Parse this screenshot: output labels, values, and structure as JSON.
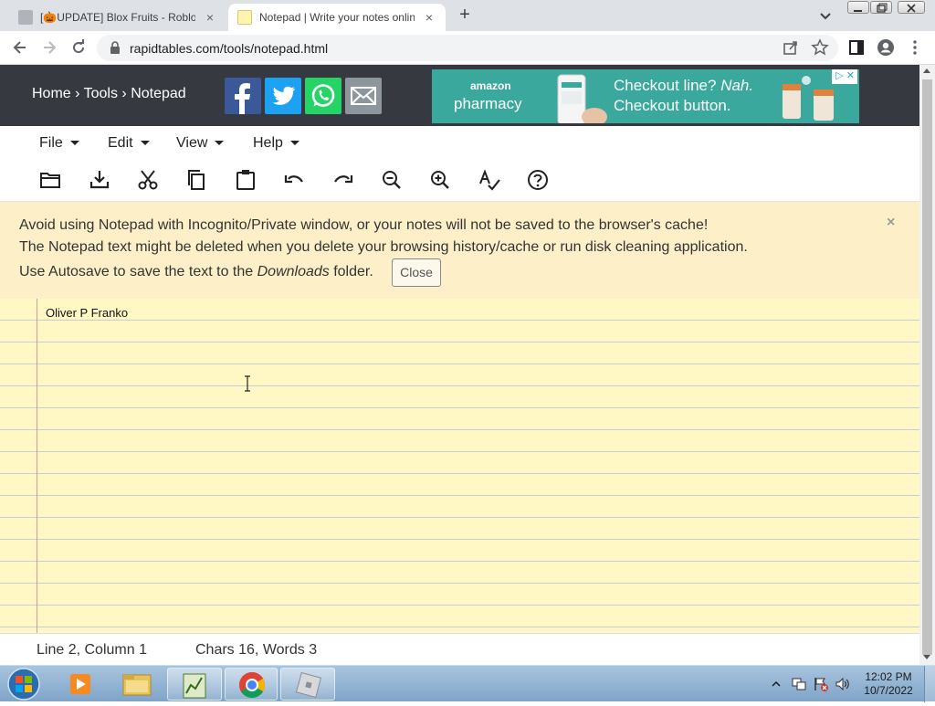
{
  "browser": {
    "tabs": [
      {
        "title": "[🎃UPDATE] Blox Fruits - Roblo",
        "active": false
      },
      {
        "title": "Notepad | Write your notes onlin",
        "active": true
      }
    ],
    "new_tab": "+",
    "close_glyph": "×",
    "url": "rapidtables.com/tools/notepad.html"
  },
  "site": {
    "breadcrumb": {
      "home": "Home",
      "sep": " › ",
      "tools": "Tools",
      "current": "Notepad"
    },
    "share_icons": [
      "facebook-icon",
      "twitter-icon",
      "whatsapp-icon",
      "email-icon"
    ],
    "ad": {
      "brand_top": "amazon",
      "brand_bottom": "pharmacy",
      "line1_pre": "Checkout line? ",
      "line1_em": "Nah.",
      "line2": "Checkout button.",
      "close": "▷ ✕"
    }
  },
  "menus": [
    {
      "label": "File"
    },
    {
      "label": "Edit"
    },
    {
      "label": "View"
    },
    {
      "label": "Help"
    }
  ],
  "toolbar_icons": [
    "open-folder-icon",
    "download-icon",
    "cut-icon",
    "copy-icon",
    "paste-icon",
    "undo-icon",
    "redo-icon",
    "zoom-out-icon",
    "zoom-in-icon",
    "spellcheck-icon",
    "help-icon"
  ],
  "banner": {
    "line1": "Avoid using Notepad with Incognito/Private window, or your notes will not be saved to the browser's cache!",
    "line2": "The Notepad text might be deleted when you delete your browsing history/cache or run disk cleaning application.",
    "line3_pre": "Use Autosave to save the text to the ",
    "line3_em": "Downloads",
    "line3_post": " folder.",
    "close_button": "Close",
    "close_x": "×"
  },
  "notepad": {
    "text": "Oliver P Franko"
  },
  "status": {
    "position": "Line 2, Column 1",
    "counts": "Chars 16, Words 3"
  },
  "taskbar": {
    "time": "12:02 PM",
    "date": "10/7/2022"
  },
  "colors": {
    "header_bg": "#363a40",
    "paper_bg": "#fff8c4",
    "banner_bg": "#fdf0c8",
    "ad_bg": "#3aa89c"
  }
}
